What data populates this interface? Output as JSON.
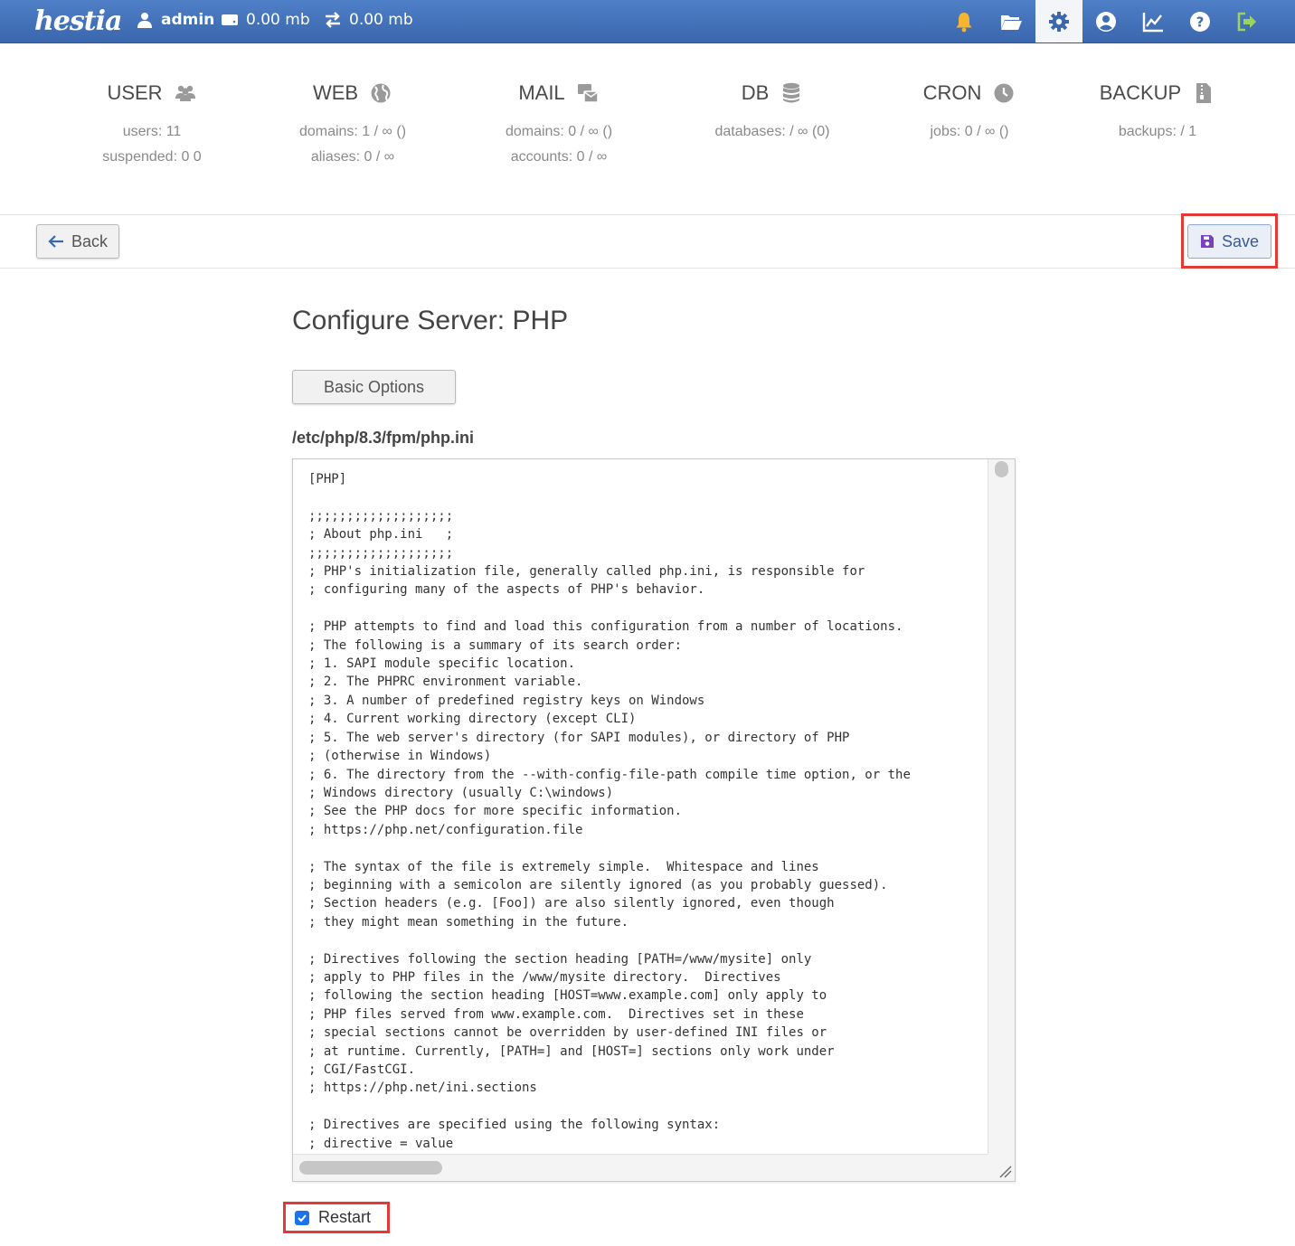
{
  "topbar": {
    "logo": "hestia",
    "username": "admin",
    "disk_usage": "0.00 mb",
    "bandwidth": "0.00 mb",
    "nav_icons": [
      "bell-icon",
      "folder-icon",
      "gear-icon",
      "user-circle-icon",
      "chart-line-icon",
      "help-icon",
      "logout-icon"
    ],
    "active_nav": "gear-icon"
  },
  "stats": {
    "user": {
      "title": "USER",
      "lines": [
        "users: 11",
        "suspended: 0 0"
      ]
    },
    "web": {
      "title": "WEB",
      "lines": [
        "domains: 1 / ∞ ()",
        "aliases: 0 / ∞"
      ]
    },
    "mail": {
      "title": "MAIL",
      "lines": [
        "domains: 0 / ∞ ()",
        "accounts: 0 / ∞"
      ]
    },
    "db": {
      "title": "DB",
      "lines": [
        "databases: / ∞ (0)"
      ]
    },
    "cron": {
      "title": "CRON",
      "lines": [
        "jobs: 0 / ∞ ()"
      ]
    },
    "backup": {
      "title": "BACKUP",
      "lines": [
        "backups: / 1"
      ]
    }
  },
  "toolbar": {
    "back_label": "Back",
    "save_label": "Save"
  },
  "main": {
    "title": "Configure Server: PHP",
    "basic_options_label": "Basic Options",
    "file_path": "/etc/php/8.3/fpm/php.ini",
    "editor_content": "[PHP]\n\n;;;;;;;;;;;;;;;;;;;\n; About php.ini   ;\n;;;;;;;;;;;;;;;;;;;\n; PHP's initialization file, generally called php.ini, is responsible for\n; configuring many of the aspects of PHP's behavior.\n\n; PHP attempts to find and load this configuration from a number of locations.\n; The following is a summary of its search order:\n; 1. SAPI module specific location.\n; 2. The PHPRC environment variable.\n; 3. A number of predefined registry keys on Windows\n; 4. Current working directory (except CLI)\n; 5. The web server's directory (for SAPI modules), or directory of PHP\n; (otherwise in Windows)\n; 6. The directory from the --with-config-file-path compile time option, or the\n; Windows directory (usually C:\\windows)\n; See the PHP docs for more specific information.\n; https://php.net/configuration.file\n\n; The syntax of the file is extremely simple.  Whitespace and lines\n; beginning with a semicolon are silently ignored (as you probably guessed).\n; Section headers (e.g. [Foo]) are also silently ignored, even though\n; they might mean something in the future.\n\n; Directives following the section heading [PATH=/www/mysite] only\n; apply to PHP files in the /www/mysite directory.  Directives\n; following the section heading [HOST=www.example.com] only apply to\n; PHP files served from www.example.com.  Directives set in these\n; special sections cannot be overridden by user-defined INI files or\n; at runtime. Currently, [PATH=] and [HOST=] sections only work under\n; CGI/FastCGI.\n; https://php.net/ini.sections\n\n; Directives are specified using the following syntax:\n; directive = value",
    "restart_label": "Restart",
    "restart_checked": true
  },
  "colors": {
    "topbar": "#4a78c0",
    "highlight": "#e53935",
    "accent": "#1a73e8"
  }
}
